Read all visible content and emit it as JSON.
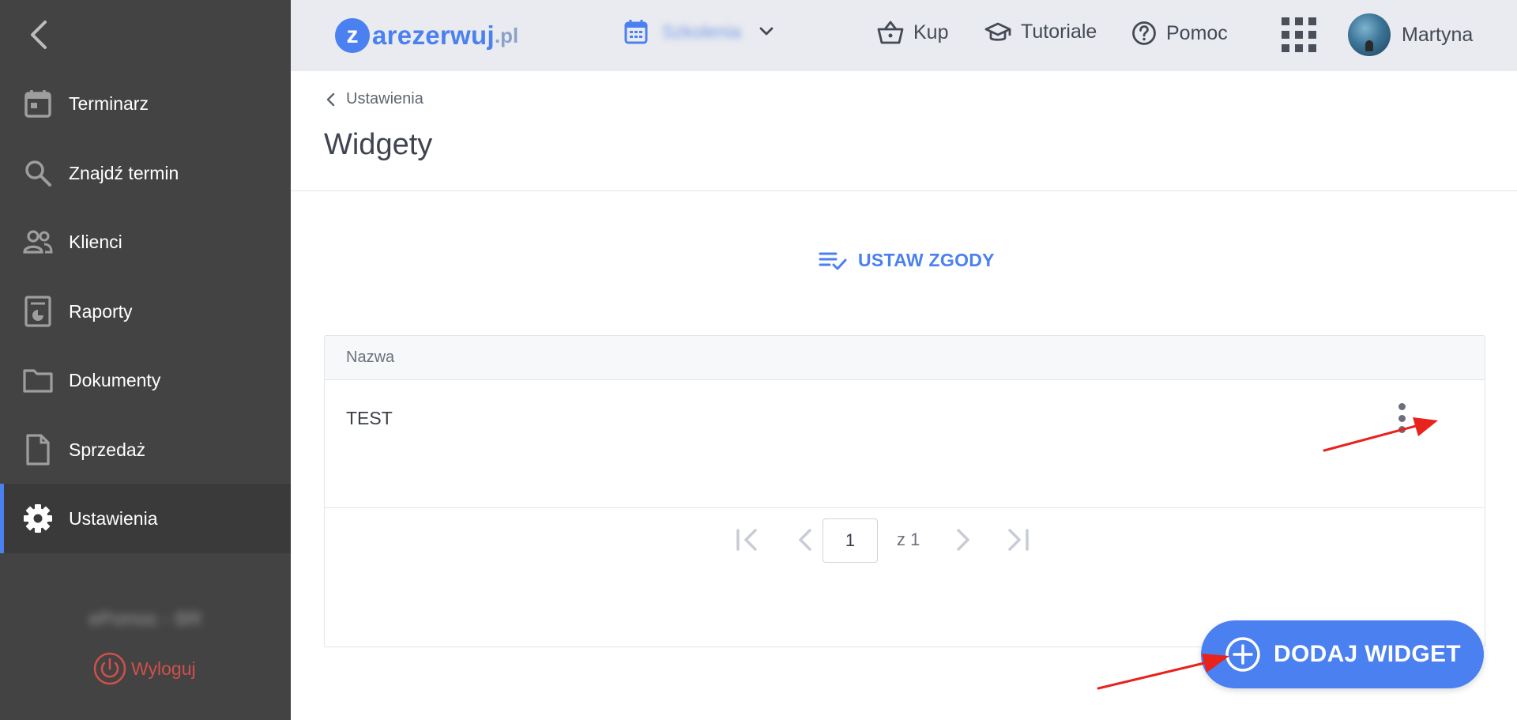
{
  "sidebar": {
    "items": [
      {
        "label": "Terminarz",
        "icon": "calendar-icon"
      },
      {
        "label": "Znajdź termin",
        "icon": "search-icon"
      },
      {
        "label": "Klienci",
        "icon": "people-icon"
      },
      {
        "label": "Raporty",
        "icon": "report-icon"
      },
      {
        "label": "Dokumenty",
        "icon": "folder-icon"
      },
      {
        "label": "Sprzedaż",
        "icon": "document-icon"
      },
      {
        "label": "Ustawienia",
        "icon": "gear-icon",
        "active": true
      }
    ],
    "user_blurred": "ePomoc - BR",
    "logout_label": "Wyloguj"
  },
  "header": {
    "logo_letter": "z",
    "logo_text": "arezerwuj",
    "logo_tld": ".pl",
    "location_blurred": "Szkolenia",
    "links": [
      {
        "label": "Kup",
        "icon": "basket-icon"
      },
      {
        "label": "Tutoriale",
        "icon": "graduation-cap-icon"
      },
      {
        "label": "Pomoc",
        "icon": "help-icon"
      }
    ],
    "user_name": "Martyna"
  },
  "main": {
    "breadcrumb": "Ustawienia",
    "title": "Widgety",
    "consent_button": "USTAW ZGODY",
    "table": {
      "column_header": "Nazwa",
      "rows": [
        {
          "name": "TEST"
        }
      ]
    },
    "pagination": {
      "current_page": "1",
      "of_label": "z 1"
    },
    "add_button": "DODAJ WIDGET"
  },
  "colors": {
    "accent": "#4a80f0",
    "sidebar_bg": "#434343",
    "header_bg": "#e9ebf0",
    "logout": "#d0504a",
    "annotation_arrow": "#e8221c"
  }
}
